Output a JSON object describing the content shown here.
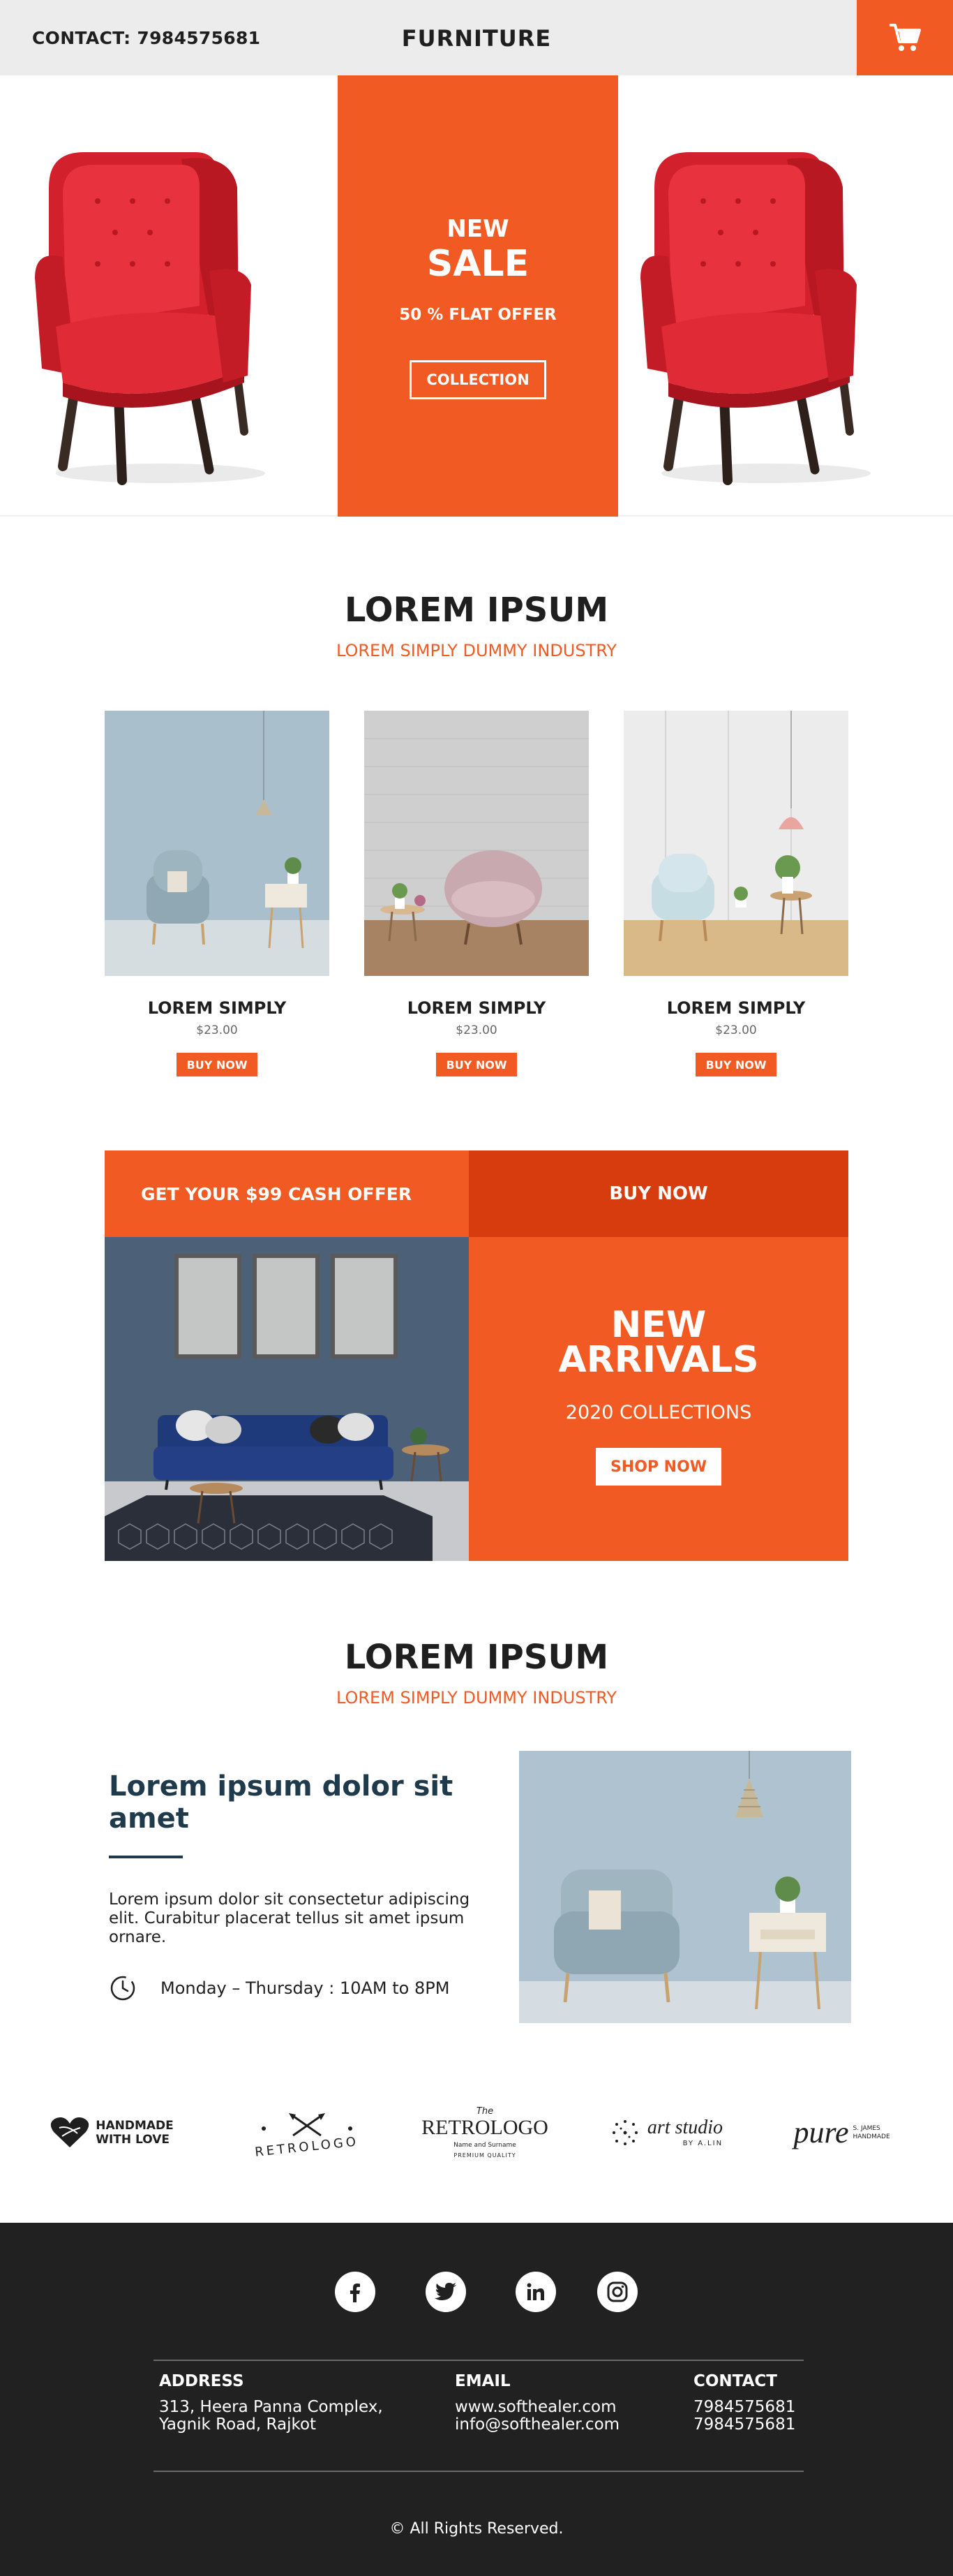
{
  "header": {
    "contact": "CONTACT: 7984575681",
    "brand": "FURNITURE",
    "cart_icon": "shopping-cart-icon",
    "accent": "#f15a22"
  },
  "hero": {
    "new": "NEW",
    "sale": "SALE",
    "offer": "50 % FLAT OFFER",
    "collection": "COLLECTION"
  },
  "section1": {
    "title": "LOREM IPSUM",
    "subtitle": "LOREM SIMPLY DUMMY INDUSTRY"
  },
  "products": [
    {
      "name": "LOREM SIMPLY",
      "price": "$23.00",
      "buy": "BUY NOW"
    },
    {
      "name": "LOREM SIMPLY",
      "price": "$23.00",
      "buy": "BUY NOW"
    },
    {
      "name": "LOREM SIMPLY",
      "price": "$23.00",
      "buy": "BUY NOW"
    }
  ],
  "offer": {
    "cash": "GET YOUR $99 CASH OFFER",
    "buy_now": "BUY NOW",
    "new": "NEW",
    "arrivals": "ARRIVALS",
    "collections": "2020 COLLECTIONS",
    "shop_now": "SHOP NOW",
    "dark_accent": "#d63c0e"
  },
  "section2": {
    "title": "LOREM IPSUM",
    "subtitle": "LOREM SIMPLY DUMMY INDUSTRY"
  },
  "about": {
    "heading": "Lorem ipsum dolor sit amet",
    "text": "Lorem ipsum dolor sit consectetur adipiscing elit. Curabitur placerat tellus sit amet ipsum ornare.",
    "hours": "Monday – Thursday : 10AM to 8PM",
    "heading_color": "#1f3a4a"
  },
  "logos": {
    "handmade_line1": "HANDMADE",
    "handmade_line2": "WITH LOVE",
    "retrologo_curved": "RETROLOGO",
    "retro_the": "The",
    "retro_main": "RETROLOGO",
    "retro_name": "Name and Surname",
    "retro_quality": "PREMIUM QUALITY",
    "art_studio": "art studio",
    "art_by": "BY A.LIN",
    "pure": "pure",
    "pure_by": "S. JAMES HANDMADE"
  },
  "footer": {
    "social": [
      "facebook-icon",
      "twitter-icon",
      "linkedin-icon",
      "instagram-icon"
    ],
    "address_label": "ADDRESS",
    "address_line1": "313, Heera Panna Complex,",
    "address_line2": "Yagnik Road, Rajkot",
    "email_label": "EMAIL",
    "email1": "www.softhealer.com",
    "email2": "info@softhealer.com",
    "contact_label": "CONTACT",
    "phone1": "7984575681",
    "phone2": "7984575681",
    "copyright": "© All Rights Reserved.",
    "bg": "#212121"
  }
}
